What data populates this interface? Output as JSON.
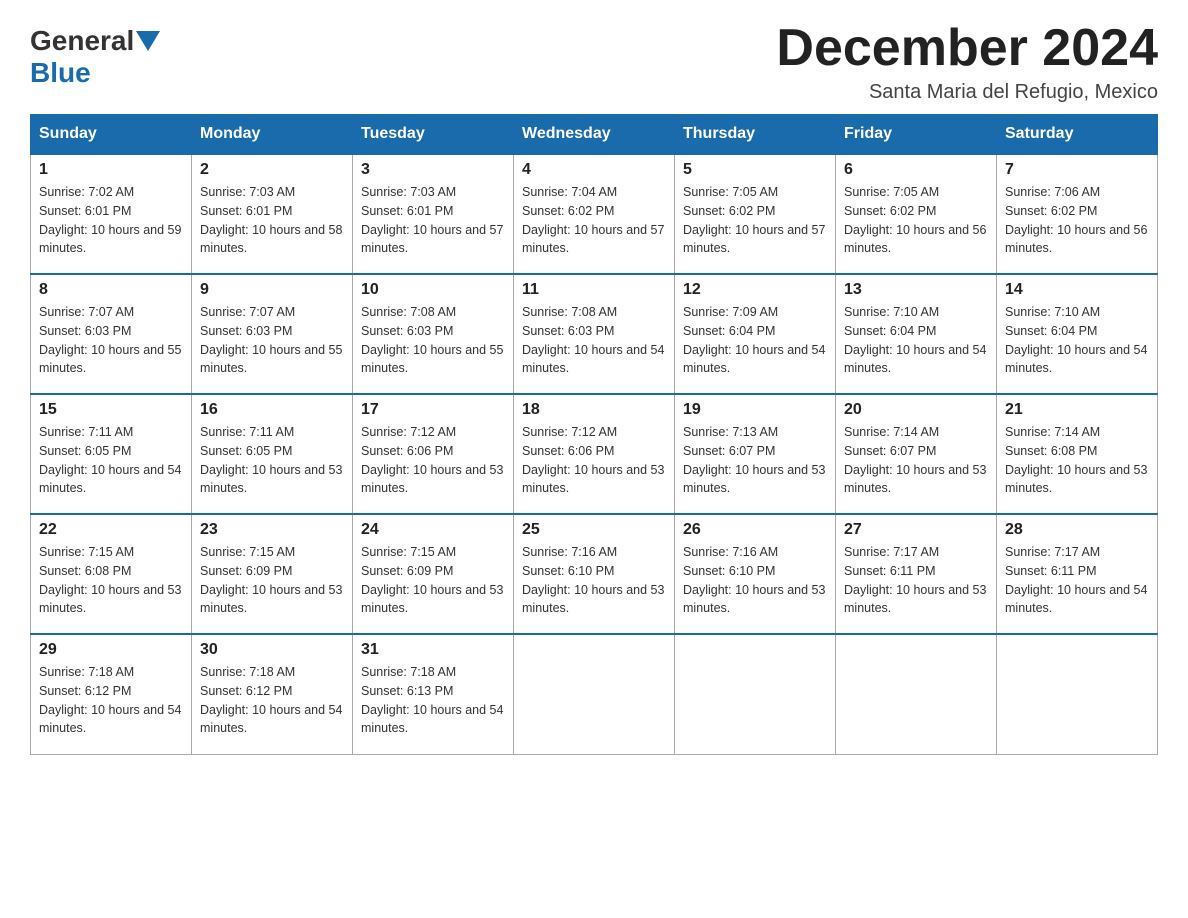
{
  "header": {
    "logo_general": "General",
    "logo_blue": "Blue",
    "month_title": "December 2024",
    "location": "Santa Maria del Refugio, Mexico"
  },
  "days_of_week": [
    "Sunday",
    "Monday",
    "Tuesday",
    "Wednesday",
    "Thursday",
    "Friday",
    "Saturday"
  ],
  "weeks": [
    [
      {
        "day": "1",
        "sunrise": "7:02 AM",
        "sunset": "6:01 PM",
        "daylight": "10 hours and 59 minutes."
      },
      {
        "day": "2",
        "sunrise": "7:03 AM",
        "sunset": "6:01 PM",
        "daylight": "10 hours and 58 minutes."
      },
      {
        "day": "3",
        "sunrise": "7:03 AM",
        "sunset": "6:01 PM",
        "daylight": "10 hours and 57 minutes."
      },
      {
        "day": "4",
        "sunrise": "7:04 AM",
        "sunset": "6:02 PM",
        "daylight": "10 hours and 57 minutes."
      },
      {
        "day": "5",
        "sunrise": "7:05 AM",
        "sunset": "6:02 PM",
        "daylight": "10 hours and 57 minutes."
      },
      {
        "day": "6",
        "sunrise": "7:05 AM",
        "sunset": "6:02 PM",
        "daylight": "10 hours and 56 minutes."
      },
      {
        "day": "7",
        "sunrise": "7:06 AM",
        "sunset": "6:02 PM",
        "daylight": "10 hours and 56 minutes."
      }
    ],
    [
      {
        "day": "8",
        "sunrise": "7:07 AM",
        "sunset": "6:03 PM",
        "daylight": "10 hours and 55 minutes."
      },
      {
        "day": "9",
        "sunrise": "7:07 AM",
        "sunset": "6:03 PM",
        "daylight": "10 hours and 55 minutes."
      },
      {
        "day": "10",
        "sunrise": "7:08 AM",
        "sunset": "6:03 PM",
        "daylight": "10 hours and 55 minutes."
      },
      {
        "day": "11",
        "sunrise": "7:08 AM",
        "sunset": "6:03 PM",
        "daylight": "10 hours and 54 minutes."
      },
      {
        "day": "12",
        "sunrise": "7:09 AM",
        "sunset": "6:04 PM",
        "daylight": "10 hours and 54 minutes."
      },
      {
        "day": "13",
        "sunrise": "7:10 AM",
        "sunset": "6:04 PM",
        "daylight": "10 hours and 54 minutes."
      },
      {
        "day": "14",
        "sunrise": "7:10 AM",
        "sunset": "6:04 PM",
        "daylight": "10 hours and 54 minutes."
      }
    ],
    [
      {
        "day": "15",
        "sunrise": "7:11 AM",
        "sunset": "6:05 PM",
        "daylight": "10 hours and 54 minutes."
      },
      {
        "day": "16",
        "sunrise": "7:11 AM",
        "sunset": "6:05 PM",
        "daylight": "10 hours and 53 minutes."
      },
      {
        "day": "17",
        "sunrise": "7:12 AM",
        "sunset": "6:06 PM",
        "daylight": "10 hours and 53 minutes."
      },
      {
        "day": "18",
        "sunrise": "7:12 AM",
        "sunset": "6:06 PM",
        "daylight": "10 hours and 53 minutes."
      },
      {
        "day": "19",
        "sunrise": "7:13 AM",
        "sunset": "6:07 PM",
        "daylight": "10 hours and 53 minutes."
      },
      {
        "day": "20",
        "sunrise": "7:14 AM",
        "sunset": "6:07 PM",
        "daylight": "10 hours and 53 minutes."
      },
      {
        "day": "21",
        "sunrise": "7:14 AM",
        "sunset": "6:08 PM",
        "daylight": "10 hours and 53 minutes."
      }
    ],
    [
      {
        "day": "22",
        "sunrise": "7:15 AM",
        "sunset": "6:08 PM",
        "daylight": "10 hours and 53 minutes."
      },
      {
        "day": "23",
        "sunrise": "7:15 AM",
        "sunset": "6:09 PM",
        "daylight": "10 hours and 53 minutes."
      },
      {
        "day": "24",
        "sunrise": "7:15 AM",
        "sunset": "6:09 PM",
        "daylight": "10 hours and 53 minutes."
      },
      {
        "day": "25",
        "sunrise": "7:16 AM",
        "sunset": "6:10 PM",
        "daylight": "10 hours and 53 minutes."
      },
      {
        "day": "26",
        "sunrise": "7:16 AM",
        "sunset": "6:10 PM",
        "daylight": "10 hours and 53 minutes."
      },
      {
        "day": "27",
        "sunrise": "7:17 AM",
        "sunset": "6:11 PM",
        "daylight": "10 hours and 53 minutes."
      },
      {
        "day": "28",
        "sunrise": "7:17 AM",
        "sunset": "6:11 PM",
        "daylight": "10 hours and 54 minutes."
      }
    ],
    [
      {
        "day": "29",
        "sunrise": "7:18 AM",
        "sunset": "6:12 PM",
        "daylight": "10 hours and 54 minutes."
      },
      {
        "day": "30",
        "sunrise": "7:18 AM",
        "sunset": "6:12 PM",
        "daylight": "10 hours and 54 minutes."
      },
      {
        "day": "31",
        "sunrise": "7:18 AM",
        "sunset": "6:13 PM",
        "daylight": "10 hours and 54 minutes."
      },
      null,
      null,
      null,
      null
    ]
  ]
}
